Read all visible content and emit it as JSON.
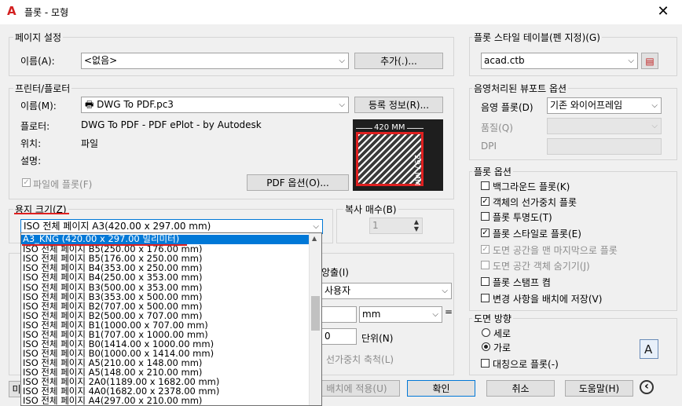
{
  "window": {
    "title": "플롯 - 모형",
    "close_symbol": "✕"
  },
  "page_setup": {
    "group_label": "페이지 설정",
    "name_label": "이름(A):",
    "name_value": "<없음>",
    "add_button": "추가(.)..."
  },
  "printer": {
    "group_label": "프린터/플로터",
    "name_label": "이름(M):",
    "name_value": "DWG To PDF.pc3",
    "properties_button": "등록 정보(R)...",
    "plotter_label": "플로터:",
    "plotter_value": "DWG To PDF - PDF ePlot - by Autodesk",
    "where_label": "위치:",
    "where_value": "파일",
    "description_label": "설명:",
    "plot_to_file_label": "파일에 플롯(F)",
    "pdf_options_button": "PDF 옵션(O)...",
    "preview_width_label": "420  MM",
    "preview_height_label": "297 MM"
  },
  "paper_size": {
    "group_label": "용지 크기(Z)",
    "selected_value": "ISO 전체 페이지 A3(420.00 x 297.00 mm)",
    "options": [
      "A3_KNG (420.00 x 297.00 밀리미터)",
      "ISO 전체 페이지 B5(250.00 x 176.00 mm)",
      "ISO 전체 페이지 B5(176.00 x 250.00 mm)",
      "ISO 전체 페이지 B4(353.00 x 250.00 mm)",
      "ISO 전체 페이지 B4(250.00 x 353.00 mm)",
      "ISO 전체 페이지 B3(500.00 x 353.00 mm)",
      "ISO 전체 페이지 B3(353.00 x 500.00 mm)",
      "ISO 전체 페이지 B2(707.00 x 500.00 mm)",
      "ISO 전체 페이지 B2(500.00 x 707.00 mm)",
      "ISO 전체 페이지 B1(1000.00 x 707.00 mm)",
      "ISO 전체 페이지 B1(707.00 x 1000.00 mm)",
      "ISO 전체 페이지 B0(1414.00 x 1000.00 mm)",
      "ISO 전체 페이지 B0(1000.00 x 1414.00 mm)",
      "ISO 전체 페이지 A5(210.00 x 148.00 mm)",
      "ISO 전체 페이지 A5(148.00 x 210.00 mm)",
      "ISO 전체 페이지 2A0(1189.00 x 1682.00 mm)",
      "ISO 전체 페이지 4A0(1682.00 x 2378.00 mm)",
      "ISO 전체 페이지 A4(297.00 x 210.00 mm)"
    ]
  },
  "copies": {
    "label": "복사 매수(B)",
    "value": "1"
  },
  "hidden_controls": {
    "center_label": "앙출(I)",
    "user_value": "사용자",
    "unit_value": "mm",
    "equals": "=",
    "scale_value": "0",
    "units_label": "단위(N)",
    "scale_lineweights_label": "선가중치 축척(L)",
    "apply_layout_button": "배치에 적용(U)"
  },
  "plot_style_table": {
    "group_label": "플롯 스타일 테이블(펜 지정)(G)",
    "value": "acad.ctb"
  },
  "shaded_viewport": {
    "group_label": "음영처리된 뷰포트 옵션",
    "shade_label": "음영 플롯(D)",
    "shade_value": "기존 와이어프레임",
    "quality_label": "품질(Q)",
    "dpi_label": "DPI"
  },
  "plot_options": {
    "group_label": "플롯 옵션",
    "items": [
      {
        "label": "백그라운드 플롯(K)",
        "checked": ""
      },
      {
        "label": "객체의 선가중치 플롯",
        "checked": "✓"
      },
      {
        "label": "플롯 투명도(T)",
        "checked": ""
      },
      {
        "label": "플롯 스타일로 플롯(E)",
        "checked": "✓"
      },
      {
        "label": "도면 공간을 맨 마지막으로 플롯",
        "checked": "✓"
      },
      {
        "label": "도면 공간 객체 숨기기(J)",
        "checked": ""
      },
      {
        "label": "플롯 스탬프 켬",
        "checked": ""
      },
      {
        "label": "변경 사항을 배치에 저장(V)",
        "checked": ""
      }
    ]
  },
  "orientation": {
    "group_label": "도면 방향",
    "portrait": "세로",
    "landscape": "가로",
    "upside_down": "대칭으로 플롯(-)",
    "icon_letter": "A"
  },
  "footer": {
    "preview_button": "미",
    "ok_button": "확인",
    "cancel_button": "취소",
    "help_button": "도움말(H)",
    "collapse_symbol": "‹"
  },
  "colors": {
    "accent": "#0078d7",
    "highlight_red": "#e02020"
  }
}
